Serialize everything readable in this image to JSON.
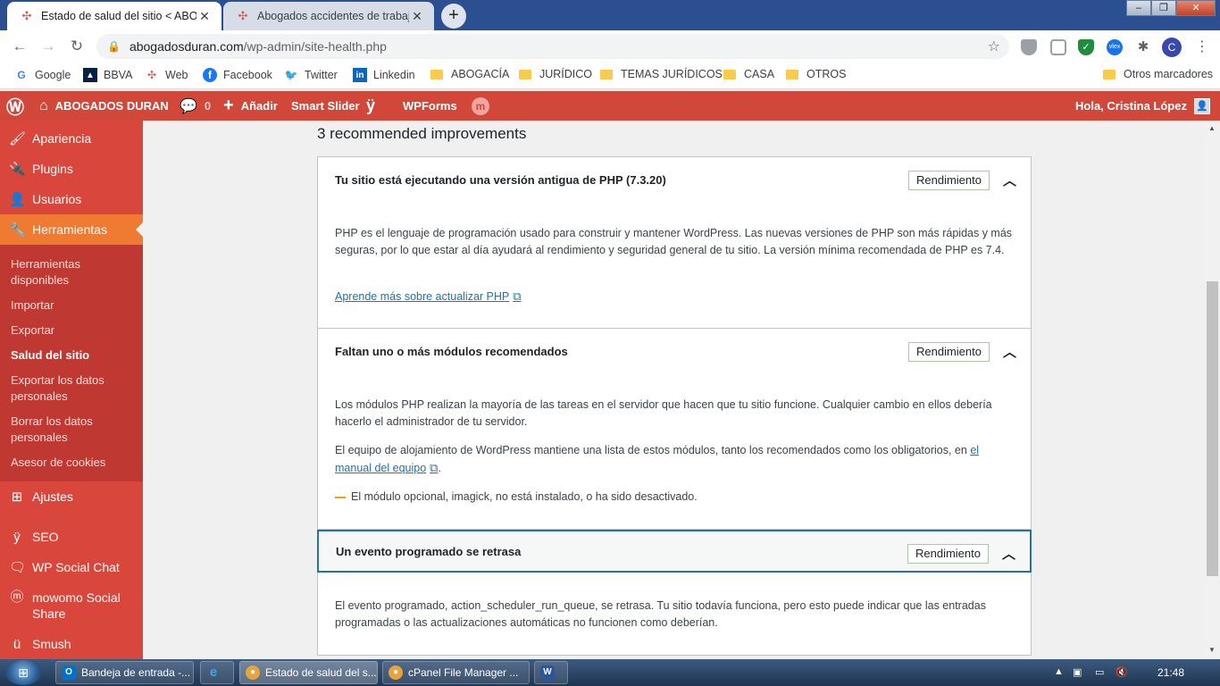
{
  "browser": {
    "tabs": [
      {
        "title": "Estado de salud del sitio < ABOG",
        "active": true
      },
      {
        "title": "Abogados accidentes de trabajo",
        "active": false
      }
    ],
    "url_host": "abogadosduran.com",
    "url_path": "/wp-admin/site-health.php",
    "profile_initial": "C"
  },
  "bookmarks": [
    {
      "label": "Google",
      "icon": "google-icon"
    },
    {
      "label": "BBVA",
      "icon": "bbva-icon"
    },
    {
      "label": "Web",
      "icon": "web-icon"
    },
    {
      "label": "Facebook",
      "icon": "facebook-icon"
    },
    {
      "label": "Twitter",
      "icon": "twitter-icon"
    },
    {
      "label": "Linkedin",
      "icon": "linkedin-icon"
    },
    {
      "label": "ABOGACÍA",
      "icon": "folder-icon"
    },
    {
      "label": "JURÍDICO",
      "icon": "folder-icon"
    },
    {
      "label": "TEMAS JURÍDICOS",
      "icon": "folder-icon"
    },
    {
      "label": "CASA",
      "icon": "folder-icon"
    },
    {
      "label": "OTROS",
      "icon": "folder-icon"
    }
  ],
  "other_bookmarks": "Otros marcadores",
  "adminbar": {
    "site_name": "ABOGADOS DURAN",
    "comments_count": "0",
    "add_new": "Añadir",
    "smart_slider": "Smart Slider",
    "wpforms": "WPForms",
    "greeting": "Hola, Cristina López"
  },
  "sidebar": {
    "items": [
      {
        "label": "Apariencia",
        "icon": "paintbrush-icon"
      },
      {
        "label": "Plugins",
        "icon": "plugin-icon"
      },
      {
        "label": "Usuarios",
        "icon": "users-icon"
      },
      {
        "label": "Herramientas",
        "icon": "wrench-icon"
      },
      {
        "label": "Ajustes",
        "icon": "settings-icon"
      },
      {
        "label": "SEO",
        "icon": "yoast-icon"
      },
      {
        "label": "WP Social Chat",
        "icon": "chat-icon"
      },
      {
        "label": "mowomo Social Share",
        "icon": "share-icon"
      },
      {
        "label": "Smush",
        "icon": "smush-icon"
      }
    ],
    "subitems": [
      "Herramientas disponibles",
      "Importar",
      "Exportar",
      "Salud del sitio",
      "Exportar los datos personales",
      "Borrar los datos personales",
      "Asesor de cookies"
    ]
  },
  "main": {
    "heading": "3 recommended improvements",
    "issues": [
      {
        "title": "Tu sitio está ejecutando una versión antigua de PHP (7.3.20)",
        "badge": "Rendimiento",
        "paragraph1": "PHP es el lenguaje de programación usado para construir y mantener WordPress. Las nuevas versiones de PHP son más rápidas y más seguras, por lo que estar al día ayudará al rendimiento y seguridad general de tu sitio. La versión mínima recomendada de PHP es 7.4.",
        "link": "Aprende más sobre actualizar PHP"
      },
      {
        "title": "Faltan uno o más módulos recomendados",
        "badge": "Rendimiento",
        "paragraph1": "Los módulos PHP realizan la mayoría de las tareas en el servidor que hacen que tu sitio funcione. Cualquier cambio en ellos debería hacerlo el administrador de tu servidor.",
        "paragraph2": "El equipo de alojamiento de WordPress mantiene una lista de estos módulos, tanto los recomendados como los obligatorios, en",
        "link": "el manual del equipo",
        "module_note": "El módulo opcional, imagick, no está instalado, o ha sido desactivado."
      },
      {
        "title": "Un evento programado se retrasa",
        "badge": "Rendimiento",
        "paragraph1": "El evento programado, action_scheduler_run_queue, se retrasa. Tu sitio todavía funciona, pero esto puede indicar que las entradas programadas o las actualizaciones automáticas no funcionen como deberían."
      }
    ]
  },
  "taskbar": {
    "tasks": [
      {
        "label": "Bandeja de entrada -...",
        "icon": "outlook-icon"
      },
      {
        "label": "Estado de salud del s...",
        "icon": "chrome-icon"
      },
      {
        "label": "cPanel File Manager ...",
        "icon": "chrome-icon"
      }
    ],
    "clock": "21:48"
  },
  "colors": {
    "admin_bar": "#d1483b",
    "sidebar": "#d9473c",
    "current_menu": "#ef7b33",
    "link": "#2271b1"
  }
}
